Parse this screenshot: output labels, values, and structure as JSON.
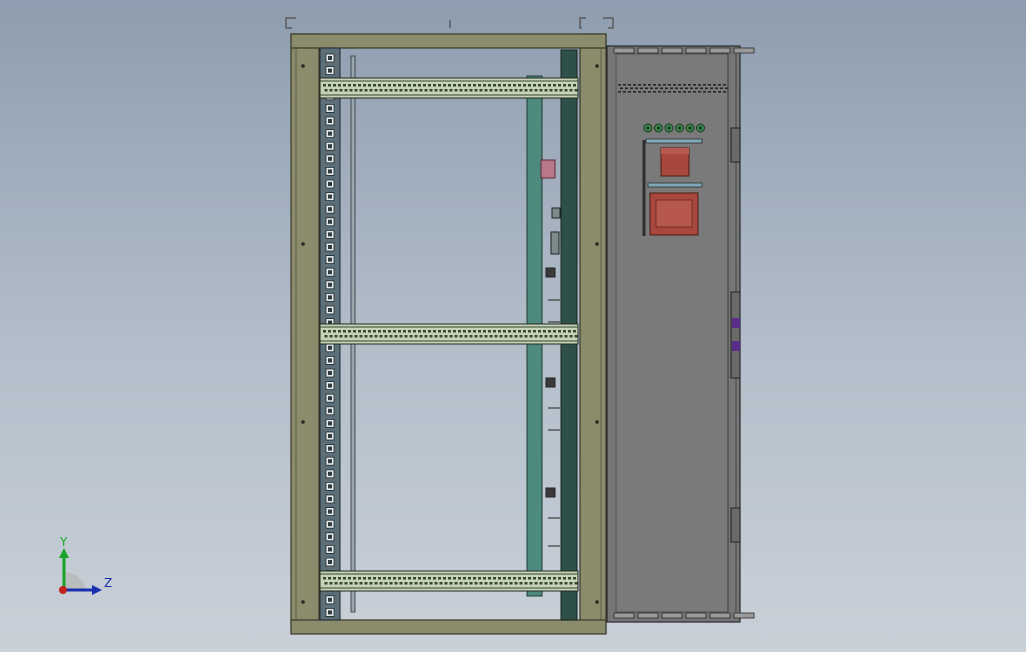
{
  "scene": {
    "background_top": "#8e9daf",
    "background_bottom": "#c9d0d8",
    "frame_color": "#8a8c6c",
    "frame_edge_color": "#3a3a2a",
    "rail_color": "#c9d2b8",
    "rail_hole_color": "#2f4a2f",
    "mount_plate_color": "#4f8a7e",
    "side_post_color": "#2f5048",
    "door_panel_color": "#767676",
    "component_color": "#a8473d",
    "indicator_color": "#3c8a52",
    "latch_color": "#5a2d8a"
  },
  "triad": {
    "y_label": "Y",
    "z_label": "Z",
    "y_color": "#1aa32a",
    "z_color": "#1a2fb0",
    "origin_color": "#c0221e"
  }
}
